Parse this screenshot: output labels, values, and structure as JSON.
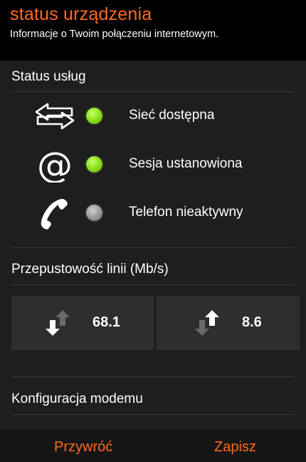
{
  "header": {
    "title": "status urządzenia",
    "subtitle": "Informacje o Twoim połączeniu internetowym."
  },
  "service_status": {
    "heading": "Status usług",
    "items": [
      {
        "icon": "network-arrows-icon",
        "state": "on",
        "label": "Sieć dostępna"
      },
      {
        "icon": "at-sign-icon",
        "state": "on",
        "label": "Sesja ustanowiona"
      },
      {
        "icon": "phone-handset-icon",
        "state": "off",
        "label": "Telefon nieaktywny"
      }
    ]
  },
  "bandwidth": {
    "heading": "Przepustowość linii (Mb/s)",
    "download": {
      "icon": "download-arrows-icon",
      "value": "68.1"
    },
    "upload": {
      "icon": "upload-arrows-icon",
      "value": "8.6"
    }
  },
  "modem": {
    "heading": "Konfiguracja modemu"
  },
  "actions": {
    "restore_label": "Przywróć",
    "save_label": "Zapisz"
  },
  "colors": {
    "accent": "#ff6a1f",
    "led_on": "#8fe41c",
    "led_off": "#9a9a9a",
    "background": "#1e1e1e"
  }
}
